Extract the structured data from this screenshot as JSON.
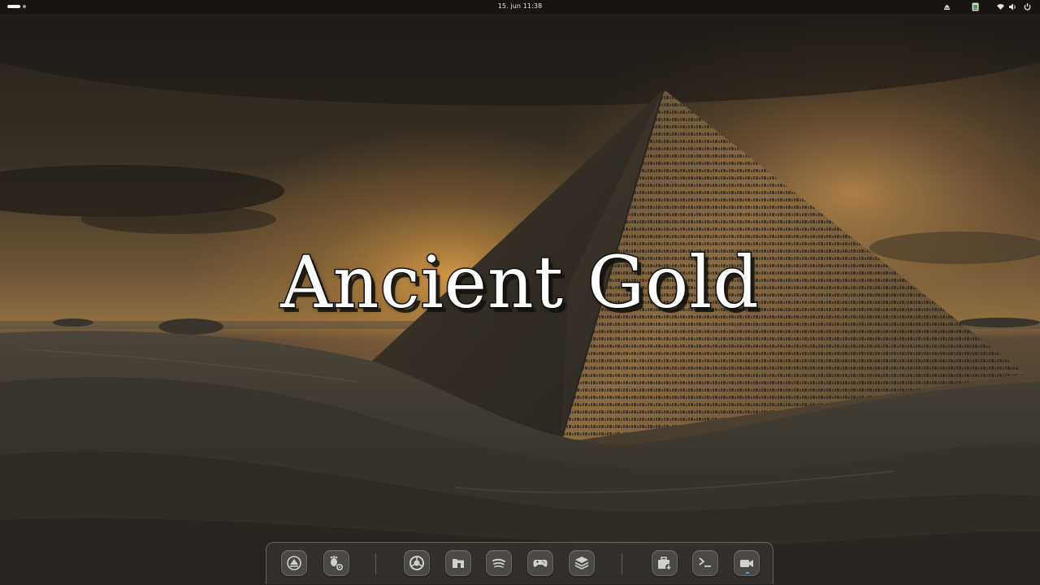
{
  "top_bar": {
    "clock": "15. jun  11:38",
    "tray_icons": [
      "eject-icon",
      "app-indicator-icon",
      "wifi-icon",
      "volume-icon",
      "power-icon"
    ]
  },
  "wallpaper": {
    "title": "Ancient Gold"
  },
  "dock": {
    "apps": [
      {
        "name": "software-updater-icon"
      },
      {
        "name": "gnome-tweaks-icon"
      },
      {
        "name": "chrome-icon"
      },
      {
        "name": "files-icon"
      },
      {
        "name": "spotify-icon"
      },
      {
        "name": "games-icon"
      },
      {
        "name": "stacks-icon"
      },
      {
        "name": "package-installer-icon"
      },
      {
        "name": "terminal-icon"
      },
      {
        "name": "screen-recorder-icon"
      }
    ]
  },
  "colors": {
    "sky_top": "#27221b",
    "glow": "#d39a47",
    "sand": "#3a352c",
    "accent_dot": "#5aa7ff"
  }
}
